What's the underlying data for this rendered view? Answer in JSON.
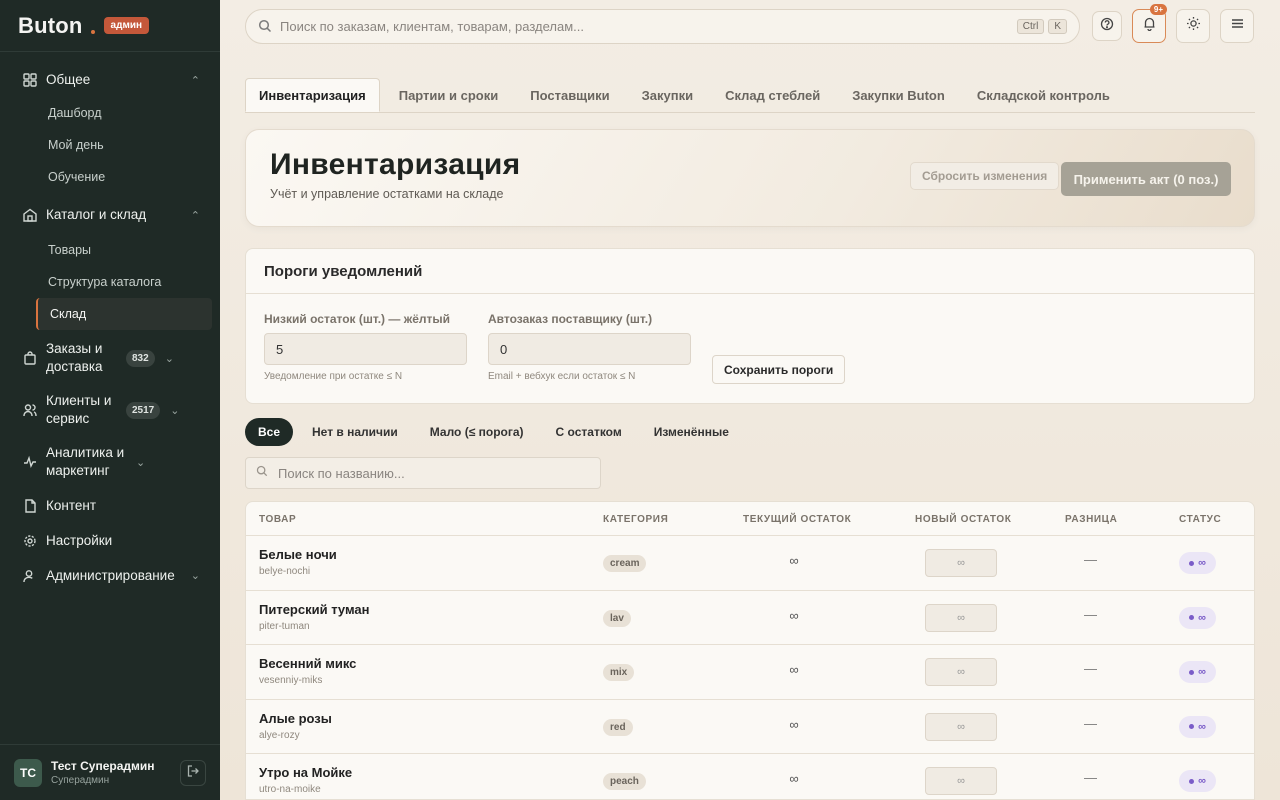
{
  "brand": {
    "name": "Buton",
    "badge": "админ"
  },
  "sidebar": {
    "groups": [
      {
        "label": "Общее",
        "icon": "grid-icon",
        "items": [
          "Дашборд",
          "Мой день",
          "Обучение"
        ]
      },
      {
        "label": "Каталог и склад",
        "icon": "warehouse-icon",
        "items": [
          "Товары",
          "Структура каталога",
          "Склад"
        ],
        "active_item": "Склад"
      },
      {
        "label": "Заказы и доставка",
        "icon": "bag-icon",
        "count": "832"
      },
      {
        "label": "Клиенты и сервис",
        "icon": "users-icon",
        "count": "2517"
      },
      {
        "label": "Аналитика и маркетинг",
        "icon": "pulse-icon"
      },
      {
        "label": "Контент",
        "icon": "file-icon"
      },
      {
        "label": "Настройки",
        "icon": "gear-icon"
      },
      {
        "label": "Администрирование",
        "icon": "user-admin-icon"
      }
    ],
    "user": {
      "initials": "ТС",
      "name": "Тест Суперадмин",
      "role": "Суперадмин"
    }
  },
  "topbar": {
    "search_placeholder": "Поиск по заказам, клиентам, товарам, разделам...",
    "shortcut_keys": [
      "Ctrl",
      "K"
    ],
    "notification_count": "9+"
  },
  "tabs": [
    "Инвентаризация",
    "Партии и сроки",
    "Поставщики",
    "Закупки",
    "Склад стеблей",
    "Закупки Buton",
    "Складской контроль"
  ],
  "page": {
    "title": "Инвентаризация",
    "subtitle": "Учёт и управление остатками на складе",
    "reset_label": "Сбросить изменения",
    "apply_label": "Применить акт (0 поз.)"
  },
  "thresholds": {
    "title": "Пороги уведомлений",
    "low_label": "Низкий остаток (шт.) — жёлтый",
    "low_value": "5",
    "low_hint": "Уведомление при остатке ≤ N",
    "auto_label": "Автозаказ поставщику (шт.)",
    "auto_value": "0",
    "auto_hint": "Email + вебхук если остаток ≤ N",
    "save_label": "Сохранить пороги"
  },
  "filters": [
    "Все",
    "Нет в наличии",
    "Мало (≤ порога)",
    "С остатком",
    "Изменённые"
  ],
  "name_search_placeholder": "Поиск по названию...",
  "table": {
    "headers": [
      "ТОВАР",
      "КАТЕГОРИЯ",
      "ТЕКУЩИЙ ОСТАТОК",
      "НОВЫЙ ОСТАТОК",
      "РАЗНИЦА",
      "СТАТУС"
    ],
    "rows": [
      {
        "name": "Белые ночи",
        "slug": "belye-nochi",
        "category": "cream",
        "current": "∞",
        "new_placeholder": "∞",
        "diff": "—",
        "status": "∞"
      },
      {
        "name": "Питерский туман",
        "slug": "piter-tuman",
        "category": "lav",
        "current": "∞",
        "new_placeholder": "∞",
        "diff": "—",
        "status": "∞"
      },
      {
        "name": "Весенний микс",
        "slug": "vesenniy-miks",
        "category": "mix",
        "current": "∞",
        "new_placeholder": "∞",
        "diff": "—",
        "status": "∞"
      },
      {
        "name": "Алые розы",
        "slug": "alye-rozy",
        "category": "red",
        "current": "∞",
        "new_placeholder": "∞",
        "diff": "—",
        "status": "∞"
      },
      {
        "name": "Утро на Мойке",
        "slug": "utro-na-moike",
        "category": "peach",
        "current": "∞",
        "new_placeholder": "∞",
        "diff": "—",
        "status": "∞"
      }
    ]
  },
  "colors": {
    "sidebar_bg": "#1f2a26",
    "accent": "#d9743f",
    "status_purple": "#7a5cc8"
  }
}
